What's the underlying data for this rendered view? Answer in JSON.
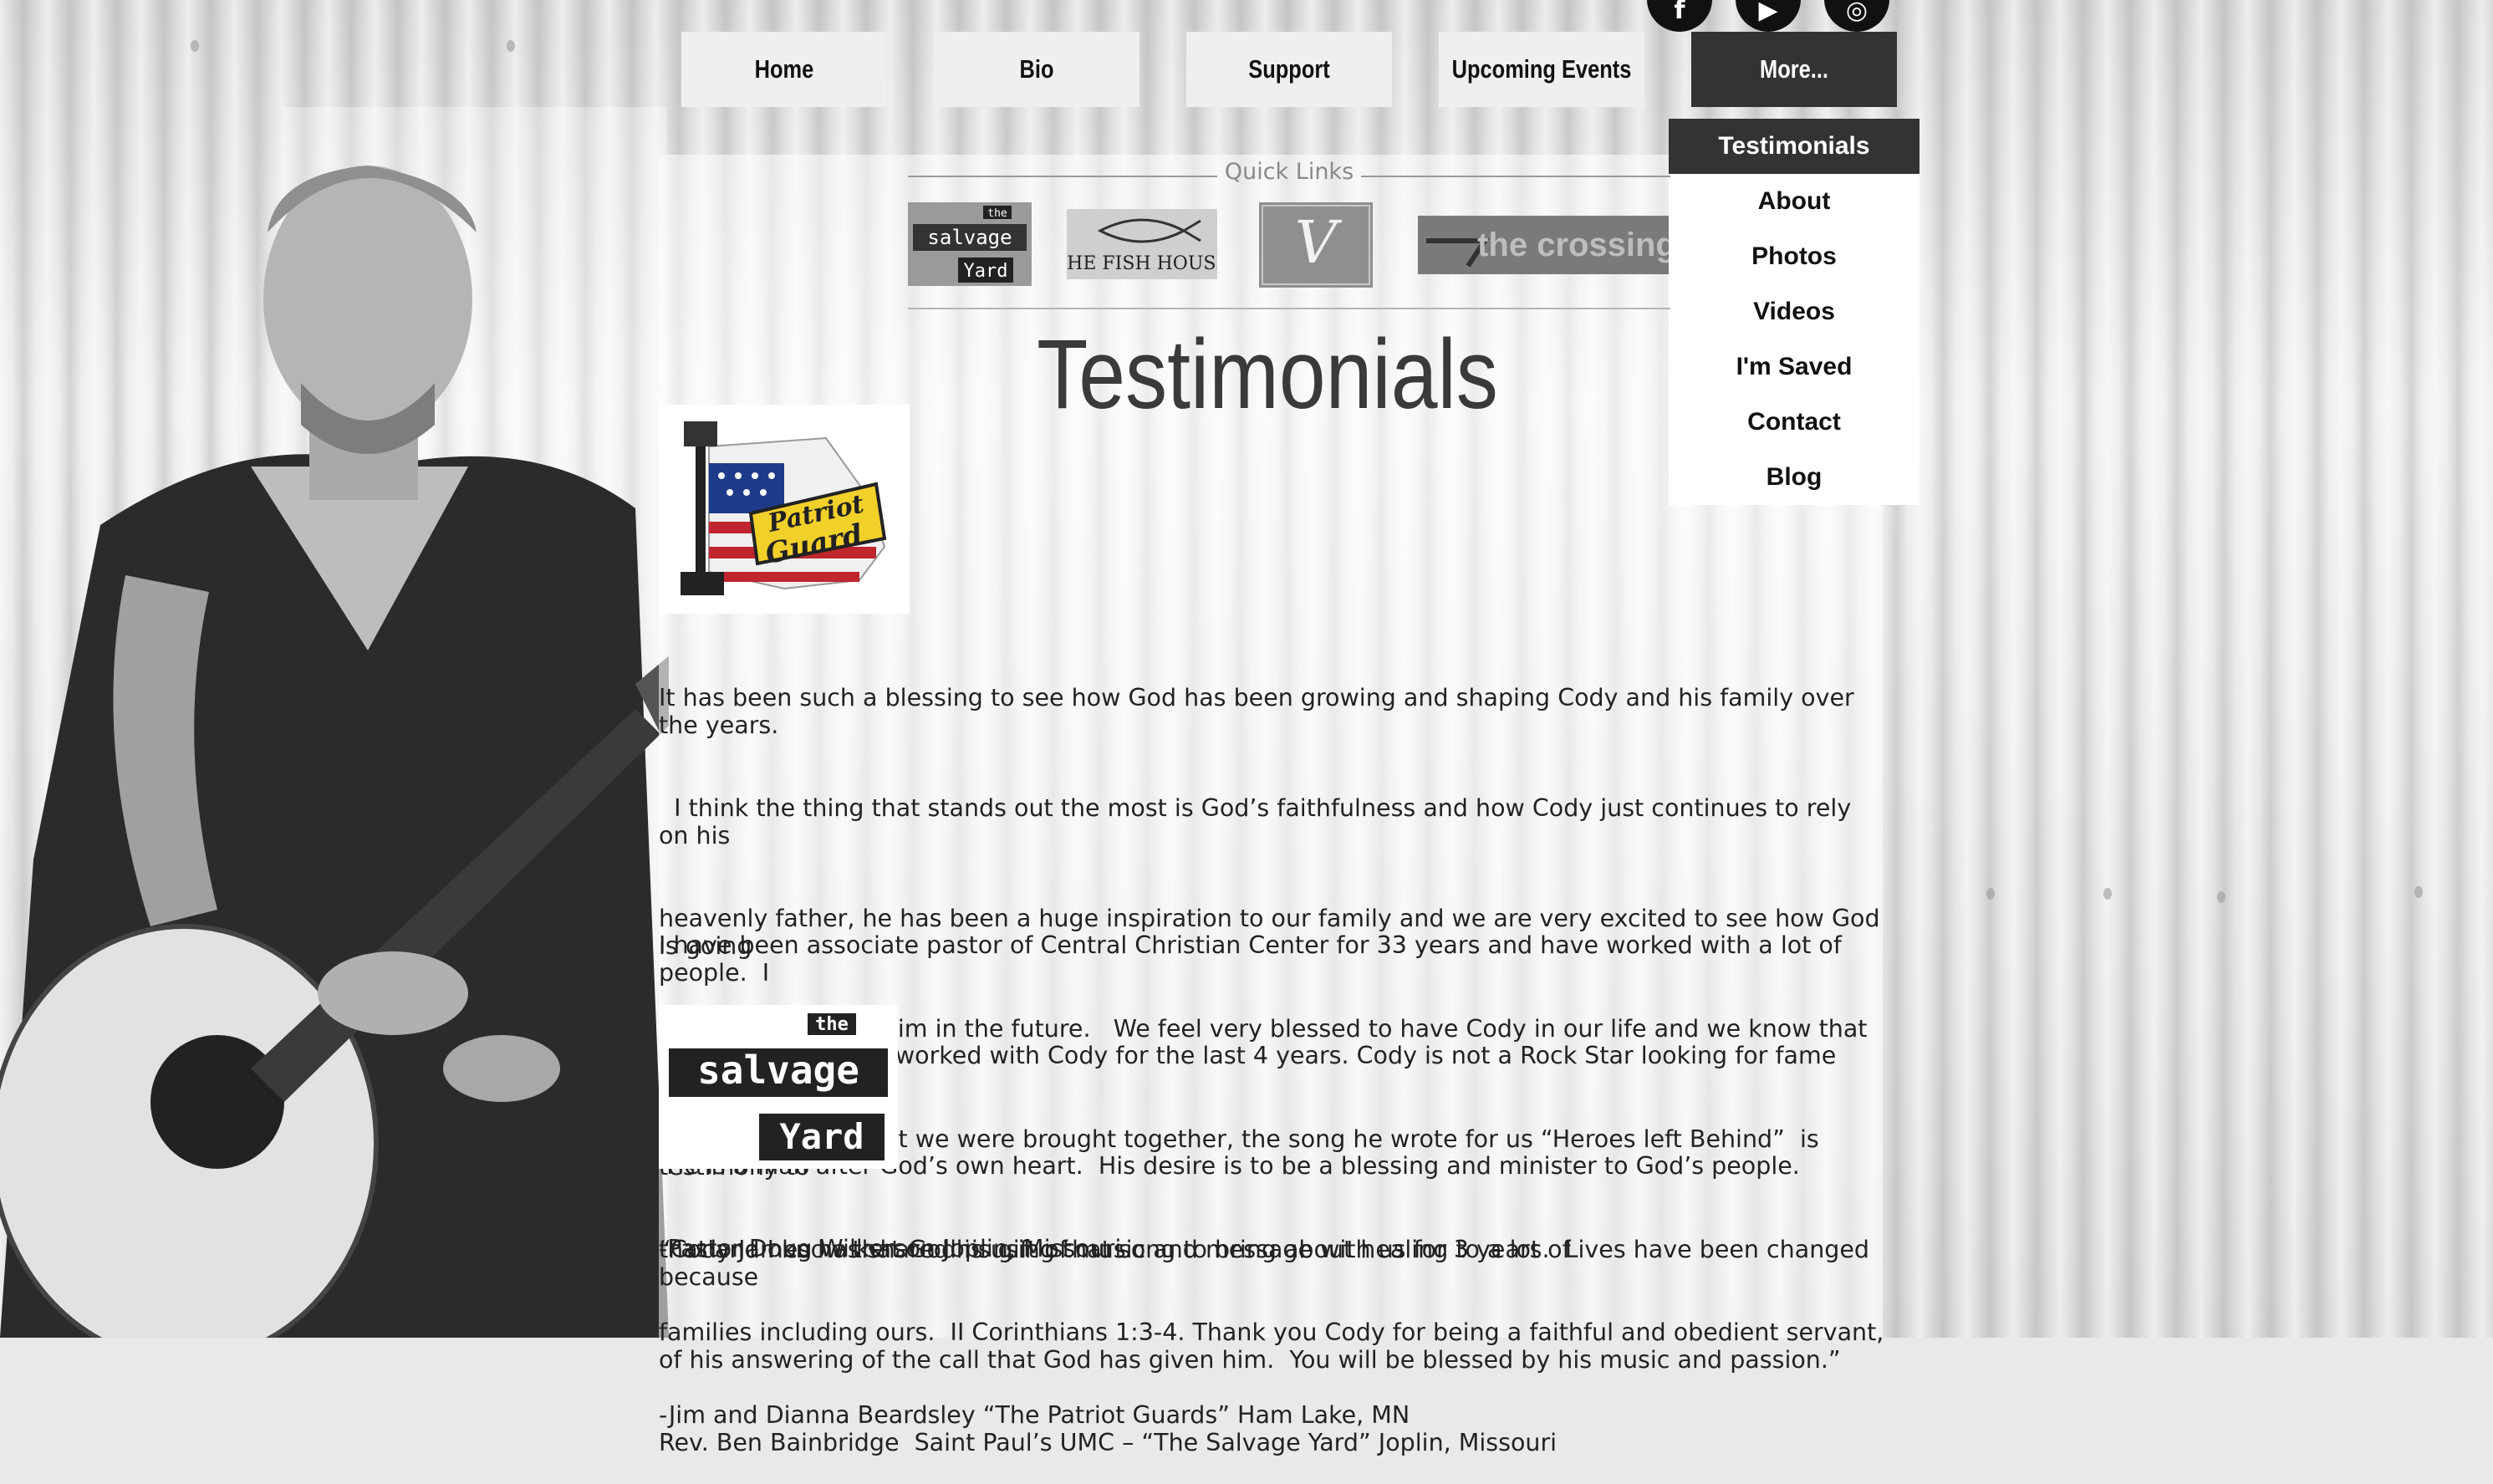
{
  "social": [
    {
      "icon": "facebook-icon",
      "glyph": "f"
    },
    {
      "icon": "youtube-icon",
      "glyph": "▶"
    },
    {
      "icon": "instagram-icon",
      "glyph": "◎"
    }
  ],
  "nav": {
    "items": [
      {
        "label": "Home"
      },
      {
        "label": "Bio"
      },
      {
        "label": "Support"
      },
      {
        "label": "Upcoming Events"
      },
      {
        "label": "More..."
      }
    ],
    "dropdown": [
      {
        "label": "Testimonials"
      },
      {
        "label": "About"
      },
      {
        "label": "Photos"
      },
      {
        "label": "Videos"
      },
      {
        "label": "I'm Saved"
      },
      {
        "label": "Contact"
      },
      {
        "label": "Blog"
      }
    ]
  },
  "quick_links": {
    "title": "Quick Links",
    "logos": [
      {
        "name": "The Salvage Yard"
      },
      {
        "name": "THE FISH HOUSE"
      },
      {
        "name": "V"
      },
      {
        "name": "the crossing"
      }
    ]
  },
  "page": {
    "title": "Testimonials",
    "patriot_logo": {
      "line1": "Patriot",
      "line2": "Guard"
    },
    "salvage_logo": {
      "line1": "the",
      "line2": "salvage",
      "line3": "Yard"
    },
    "testimonial1": {
      "lines": [
        "It has been such a blessing to see how God has been growing and shaping Cody and his family over the years.",
        "  I think the thing that stands out the most is God’s faithfulness and how Cody just continues to rely on his",
        "heavenly father, he has been a huge inspiration to our family and we are very excited to see how God is going",
        "to continue to use him in the future.   We feel very blessed to have Cody in our life and we know that it is by",
        "the hand of God that we were brought together, the song he wrote for us “Heroes left Behind”  is testimony to",
        "that and I know that God is using that song to bring about healing to a lot of",
        "families including ours.  II Corinthians 1:3-4. Thank you Cody for being a faithful and obedient servant,",
        "-Jim and Dianna Beardsley “The Patriot Guards” Ham Lake, MN"
      ]
    },
    "testimonial2": {
      "lines": [
        "I have been associate pastor of Central Christian Center for 33 years and have worked with a lot of people.  I",
        "have observed and worked with Cody for the last 4 years. Cody is not a Rock Star looking for fame and power.",
        " He is a man after God’s own heart.  His desire is to be a blessing and minister to God’s people.",
        "-Pastor Doug Wilkerson Joplin, Missouri"
      ]
    },
    "testimonial3": {
      "lines": [
        "“Cody James has shared his gift of music and message with us for 3 years.  Lives have been changed because",
        "of his answering of the call that God has given him.  You will be blessed by his music and passion.”",
        "Rev. Ben Bainbridge  Saint Paul’s UMC – “The Salvage Yard” Joplin, Missouri"
      ]
    }
  }
}
